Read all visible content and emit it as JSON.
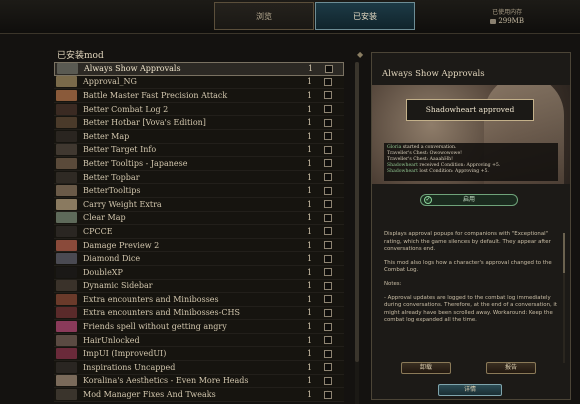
{
  "tabs": {
    "browse": "浏览",
    "installed": "已安装"
  },
  "storage": {
    "label": "已使用内存",
    "size": "299MB"
  },
  "list": {
    "title": "已安装mod",
    "items": [
      {
        "name": "Always Show Approvals",
        "num": "1",
        "thumb": "#5a5a52"
      },
      {
        "name": "Approval_NG",
        "num": "1",
        "thumb": "#7a6a4a"
      },
      {
        "name": "Battle Master Fast Precision Attack",
        "num": "1",
        "thumb": "#8a5a3a"
      },
      {
        "name": "Better Combat Log 2",
        "num": "1",
        "thumb": "#3a2a22"
      },
      {
        "name": "Better Hotbar [Vova's Edition]",
        "num": "1",
        "thumb": "#4a3a2a"
      },
      {
        "name": "Better Map",
        "num": "1",
        "thumb": "#2a2520"
      },
      {
        "name": "Better Target Info",
        "num": "1",
        "thumb": "#403830"
      },
      {
        "name": "Better Tooltips - Japanese",
        "num": "1",
        "thumb": "#5a4a3a"
      },
      {
        "name": "Better Topbar",
        "num": "1",
        "thumb": "#2f2a24"
      },
      {
        "name": "BetterTooltips",
        "num": "1",
        "thumb": "#6a5a48"
      },
      {
        "name": "Carry Weight Extra",
        "num": "1",
        "thumb": "#8a7a60"
      },
      {
        "name": "Clear Map",
        "num": "1",
        "thumb": "#5e6a5a"
      },
      {
        "name": "CPCCE",
        "num": "1",
        "thumb": "#2a2622"
      },
      {
        "name": "Damage Preview 2",
        "num": "1",
        "thumb": "#8a4a3a"
      },
      {
        "name": "Diamond Dice",
        "num": "1",
        "thumb": "#4a4a52"
      },
      {
        "name": "DoubleXP",
        "num": "1",
        "thumb": "#1a1816"
      },
      {
        "name": "Dynamic Sidebar",
        "num": "1",
        "thumb": "#3a322a"
      },
      {
        "name": "Extra encounters and Minibosses",
        "num": "1",
        "thumb": "#6a3a2a"
      },
      {
        "name": "Extra encounters and Minibosses-CHS",
        "num": "1",
        "thumb": "#5a2a2a"
      },
      {
        "name": "Friends spell without getting angry",
        "num": "1",
        "thumb": "#8a3a5a"
      },
      {
        "name": "HairUnlocked",
        "num": "1",
        "thumb": "#5a4a42"
      },
      {
        "name": "ImpUI (ImprovedUI)",
        "num": "1",
        "thumb": "#6a2a3a"
      },
      {
        "name": "Inspirations Uncapped",
        "num": "1",
        "thumb": "#2a2622"
      },
      {
        "name": "Koralina's Aesthetics - Even More Heads",
        "num": "1",
        "thumb": "#7a6a5a"
      },
      {
        "name": "Mod Manager Fixes And Tweaks",
        "num": "1",
        "thumb": "#3a342c"
      }
    ]
  },
  "detail": {
    "title": "Always Show Approvals",
    "preview": {
      "banner": "Shadowheart approved",
      "log": [
        {
          "who": "Gloria",
          "text": " started a conversation."
        },
        {
          "who": "",
          "text": "Traveller's Chest: Owowowowe!"
        },
        {
          "who": "",
          "text": "Traveller's Chest: AaaahHh!"
        },
        {
          "who": "Shadowheart",
          "text": " received Condition: Approving +5."
        },
        {
          "who": "Shadowheart",
          "text": " lost Condition: Approving +5."
        }
      ]
    },
    "enabled_label": "启用",
    "description": [
      "Displays approval popups for companions with \"Exceptional\" rating, which the game silences by default. They appear after conversations end.",
      "This mod also logs how a character's approval changed to the Combat Log.",
      "Notes:",
      "- Approval updates are logged to the combat log immediately during conversations. Therefore, at the end of a conversation, it might already have been scrolled away. Workaround: Keep the combat log expanded all the time."
    ],
    "uninstall_label": "卸载",
    "report_label": "报告",
    "details_label": "详情"
  }
}
